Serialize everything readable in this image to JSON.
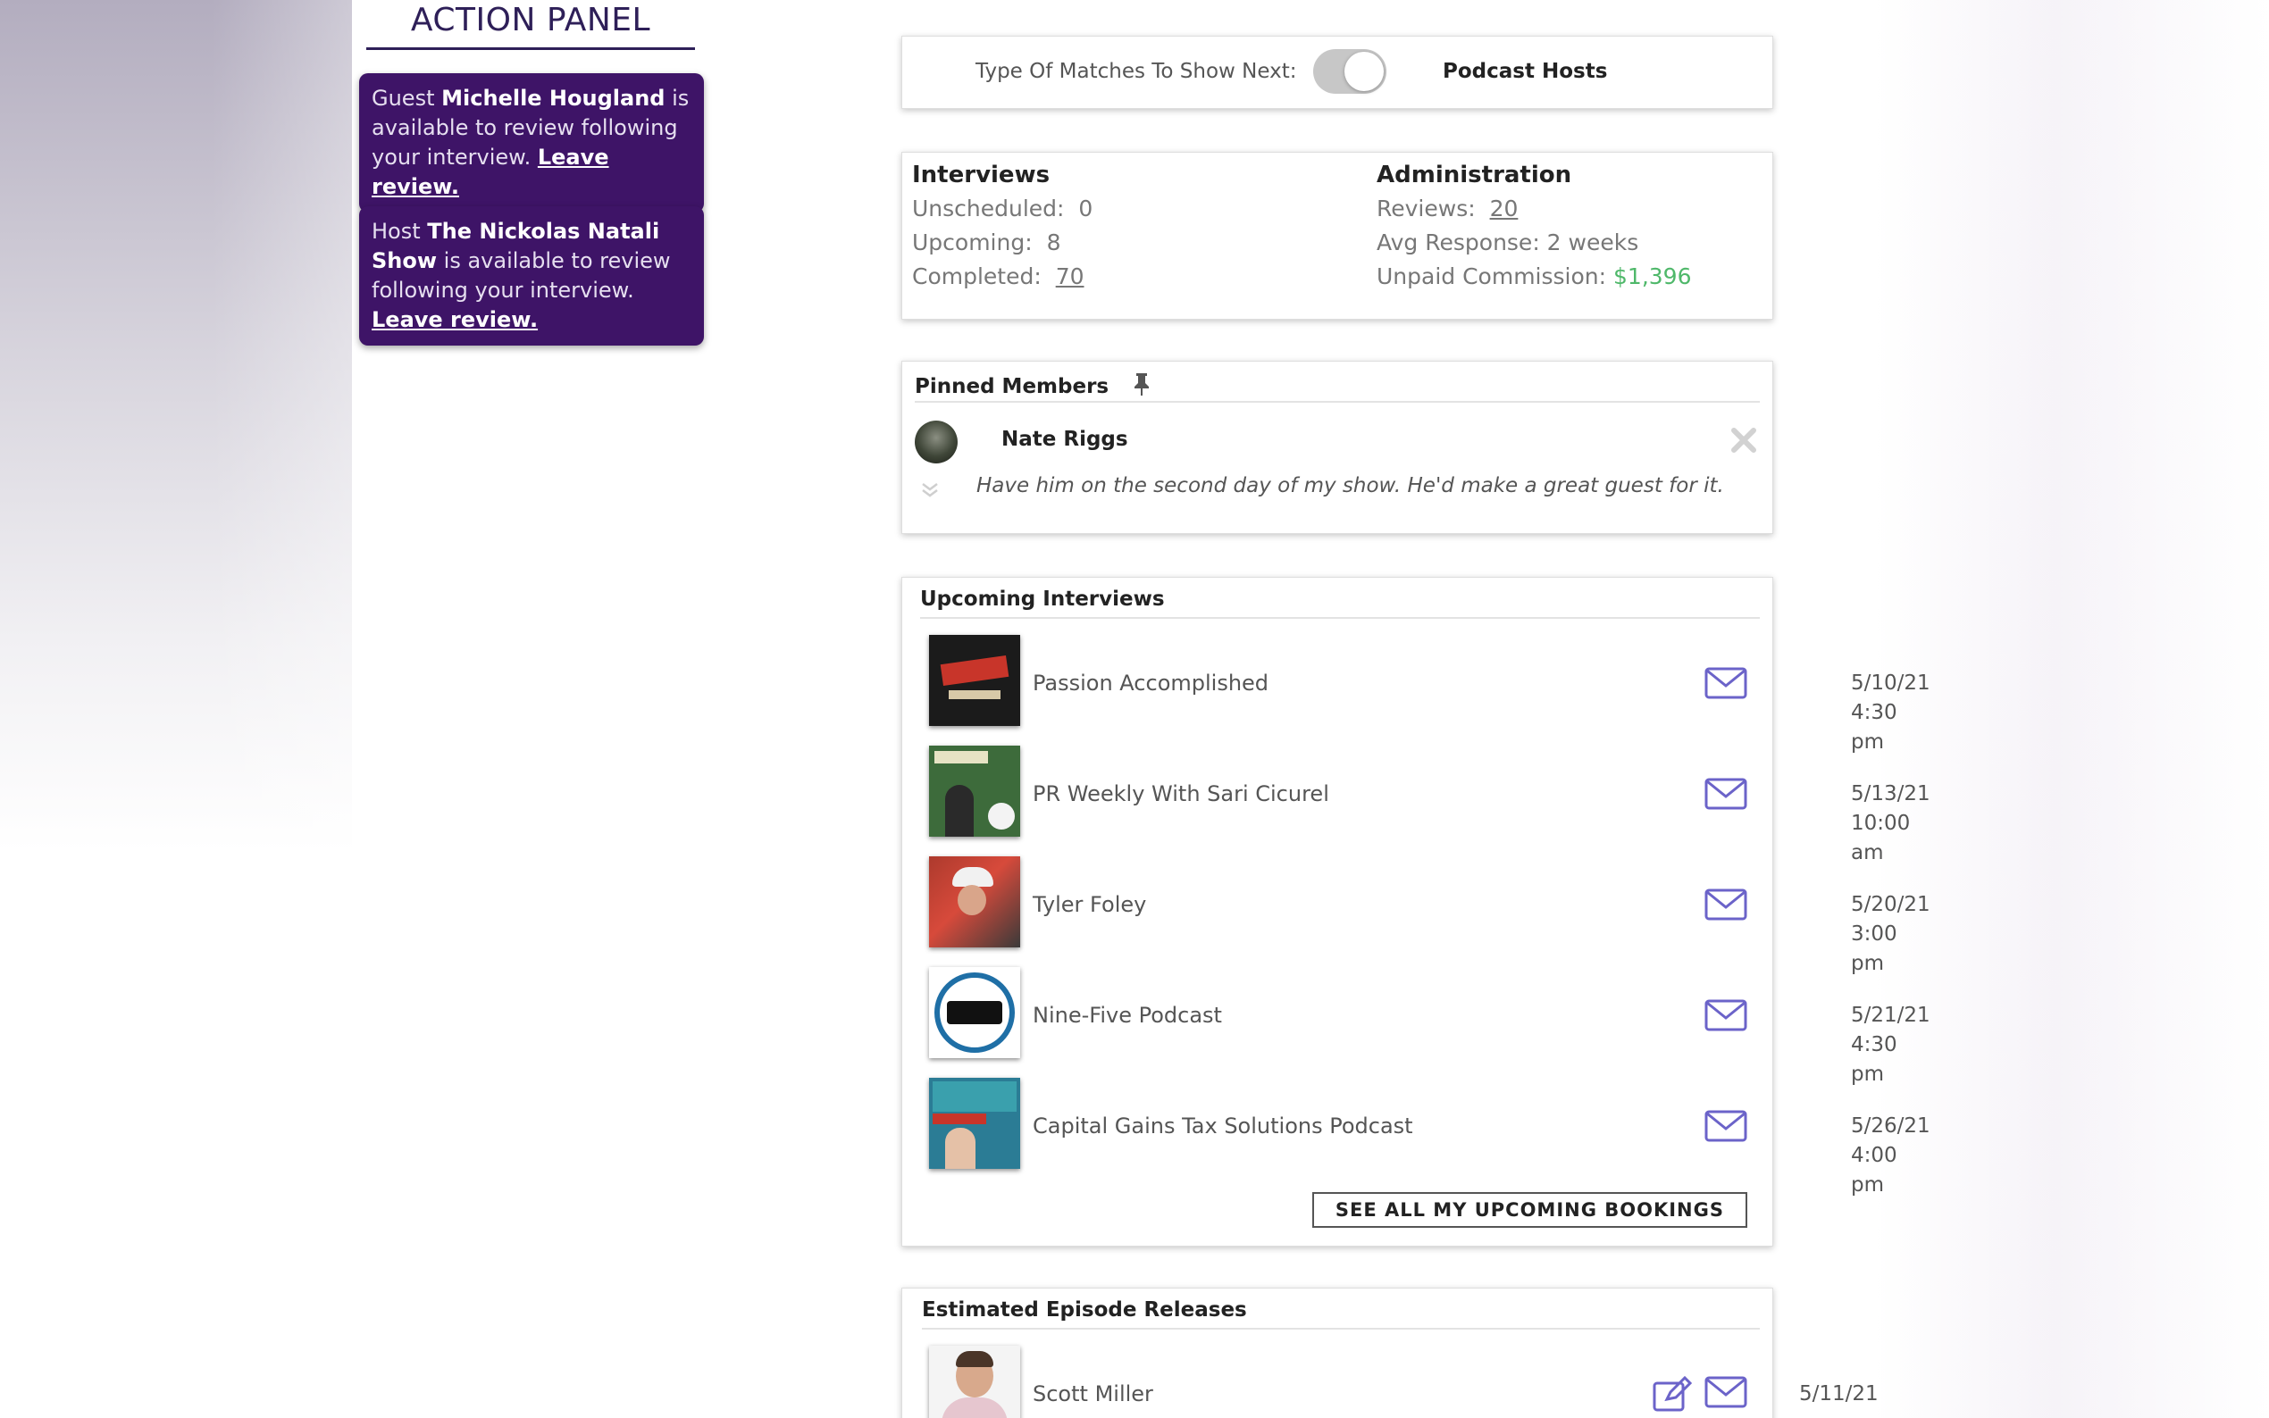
{
  "action_panel": {
    "title": "ACTION PANEL",
    "cards": [
      {
        "prefix": "Guest",
        "name": "Michelle Hougland",
        "text": "is available to review following your interview.",
        "link": "Leave review."
      },
      {
        "prefix": "Host",
        "name": "The Nickolas Natali Show",
        "text": "is available to review following your interview.",
        "link": "Leave review."
      }
    ]
  },
  "match_toggle": {
    "label": "Type Of Matches To Show Next:",
    "value": "Podcast Hosts"
  },
  "stats": {
    "interviews": {
      "heading": "Interviews",
      "unscheduled_label": "Unscheduled:",
      "unscheduled": "0",
      "upcoming_label": "Upcoming:",
      "upcoming": "8",
      "completed_label": "Completed:",
      "completed": "70"
    },
    "administration": {
      "heading": "Administration",
      "reviews_label": "Reviews:",
      "reviews": "20",
      "avg_response": "Avg Response: 2 weeks",
      "commission_label": "Unpaid Commission:",
      "commission": "$1,396"
    }
  },
  "pinned": {
    "heading": "Pinned Members",
    "member_name": "Nate Riggs",
    "note": "Have him on the second day of my show. He'd make a great guest for it."
  },
  "upcoming": {
    "heading": "Upcoming Interviews",
    "items": [
      {
        "title": "Passion Accomplished",
        "date": "5/10/21",
        "time": "4:30 pm"
      },
      {
        "title": "PR Weekly With Sari Cicurel",
        "date": "5/13/21",
        "time": "10:00 am"
      },
      {
        "title": "Tyler Foley",
        "date": "5/20/21",
        "time": "3:00 pm"
      },
      {
        "title": "Nine-Five Podcast",
        "date": "5/21/21",
        "time": "4:30 pm"
      },
      {
        "title": "Capital Gains Tax Solutions Podcast",
        "date": "5/26/21",
        "time": "4:00 pm"
      }
    ],
    "see_all": "SEE ALL MY UPCOMING BOOKINGS"
  },
  "releases": {
    "heading": "Estimated Episode Releases",
    "items": [
      {
        "title": "Scott Miller",
        "date": "5/11/21"
      }
    ]
  },
  "colors": {
    "accent_purple": "#3e1467",
    "icon_purple": "#6b63c9",
    "commission_green": "#4fb86a"
  },
  "icons": [
    "pin-icon",
    "close-icon",
    "chevron-down-icon",
    "mail-icon",
    "edit-icon"
  ]
}
